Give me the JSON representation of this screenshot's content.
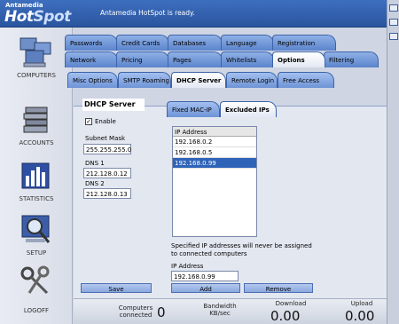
{
  "header": {
    "brand_small": "Antamedia",
    "brand_big_1": "Hot",
    "brand_big_2": "Spot",
    "status": "Antamedia HotSpot is ready."
  },
  "sidebar": {
    "items": [
      {
        "label": "COMPUTERS",
        "icon": "computers-icon"
      },
      {
        "label": "ACCOUNTS",
        "icon": "accounts-icon"
      },
      {
        "label": "STATISTICS",
        "icon": "statistics-icon"
      },
      {
        "label": "SETUP",
        "icon": "setup-icon"
      },
      {
        "label": "LOGOFF",
        "icon": "keys-icon"
      }
    ]
  },
  "tabs": {
    "row1": [
      "Passwords",
      "Credit Cards",
      "Databases",
      "Language",
      "Registration"
    ],
    "row2": [
      "Network",
      "Pricing",
      "Pages",
      "Whitelists",
      "Options",
      "Filtering"
    ],
    "row3": [
      "Misc Options",
      "SMTP Roaming",
      "DHCP Server",
      "Remote Login",
      "Free Access"
    ],
    "active_row2": "Options",
    "active_row3": "DHCP Server"
  },
  "dhcp": {
    "title": "DHCP Server",
    "enable_label": "Enable",
    "enable_checked": true,
    "subnet_label": "Subnet Mask",
    "subnet_value": "255.255.255.0",
    "dns1_label": "DNS 1",
    "dns1_value": "212.128.0.12",
    "dns2_label": "DNS 2",
    "dns2_value": "212.128.0.13",
    "save_label": "Save"
  },
  "subtabs": [
    "Fixed MAC-IP",
    "Excluded IPs"
  ],
  "active_subtab": "Excluded IPs",
  "excluded": {
    "column": "IP Address",
    "rows": [
      "192.168.0.2",
      "192.168.0.5",
      "192.168.0.99"
    ],
    "selected_index": 2,
    "note_1": "Specified IP addresses will never be assigned",
    "note_2": "to connected computers",
    "ip_label": "IP Address",
    "ip_value": "192.168.0.99",
    "add_label": "Add",
    "remove_label": "Remove"
  },
  "footer": {
    "computers_label_1": "Computers",
    "computers_label_2": "connected",
    "computers_value": "0",
    "bandwidth_label_1": "Bandwidth",
    "bandwidth_label_2": "KB/sec",
    "download_label": "Download",
    "download_value": "0.00",
    "upload_label": "Upload",
    "upload_value": "0.00"
  }
}
